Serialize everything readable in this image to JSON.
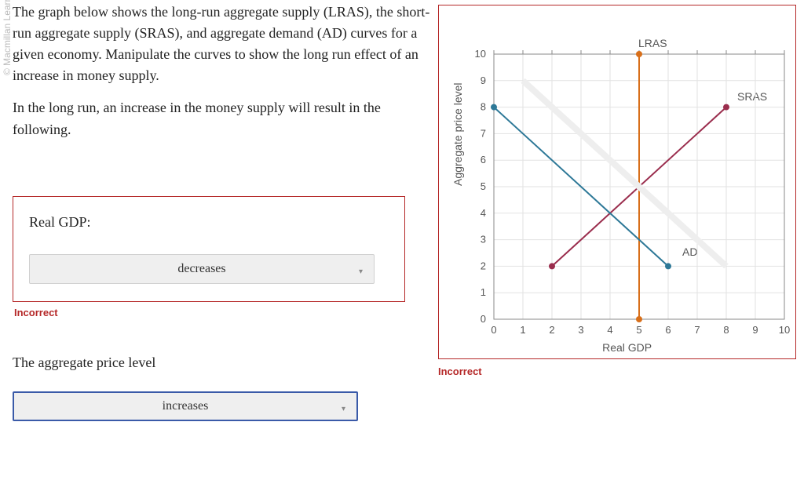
{
  "watermark": "© Macmillan Learning",
  "prompt_p1": "The graph below shows the long-run aggregate supply (LRAS), the short-run aggregate supply (SRAS), and aggregate demand (AD) curves for a given economy. Manipulate the curves to show the long run effect of an increase in money supply.",
  "prompt_p2": "In the long run, an increase in the money supply will result in the following.",
  "q1": {
    "label": "Real GDP:",
    "selected": "decreases",
    "feedback": "Incorrect"
  },
  "q2": {
    "label": "The aggregate price level",
    "selected": "increases"
  },
  "chart_feedback": "Incorrect",
  "chart_data": {
    "type": "line",
    "title": "",
    "xlabel": "Real GDP",
    "ylabel": "Aggregate price level",
    "xlim": [
      0,
      10
    ],
    "ylim": [
      0,
      10
    ],
    "grid": true,
    "series": [
      {
        "name": "LRAS",
        "x": [
          5,
          5
        ],
        "y": [
          0,
          10
        ],
        "color": "#d86f1a"
      },
      {
        "name": "SRAS",
        "x": [
          2,
          8
        ],
        "y": [
          2,
          8
        ],
        "color": "#9a2d4d"
      },
      {
        "name": "AD",
        "x": [
          0,
          6
        ],
        "y": [
          8,
          2
        ],
        "color": "#2d7897"
      }
    ],
    "labels": [
      {
        "text": "LRAS",
        "x": 5,
        "y": 10.3
      },
      {
        "text": "SRAS",
        "x": 8.4,
        "y": 7.6
      },
      {
        "text": "AD",
        "x": 6.3,
        "y": 2.3
      }
    ]
  }
}
